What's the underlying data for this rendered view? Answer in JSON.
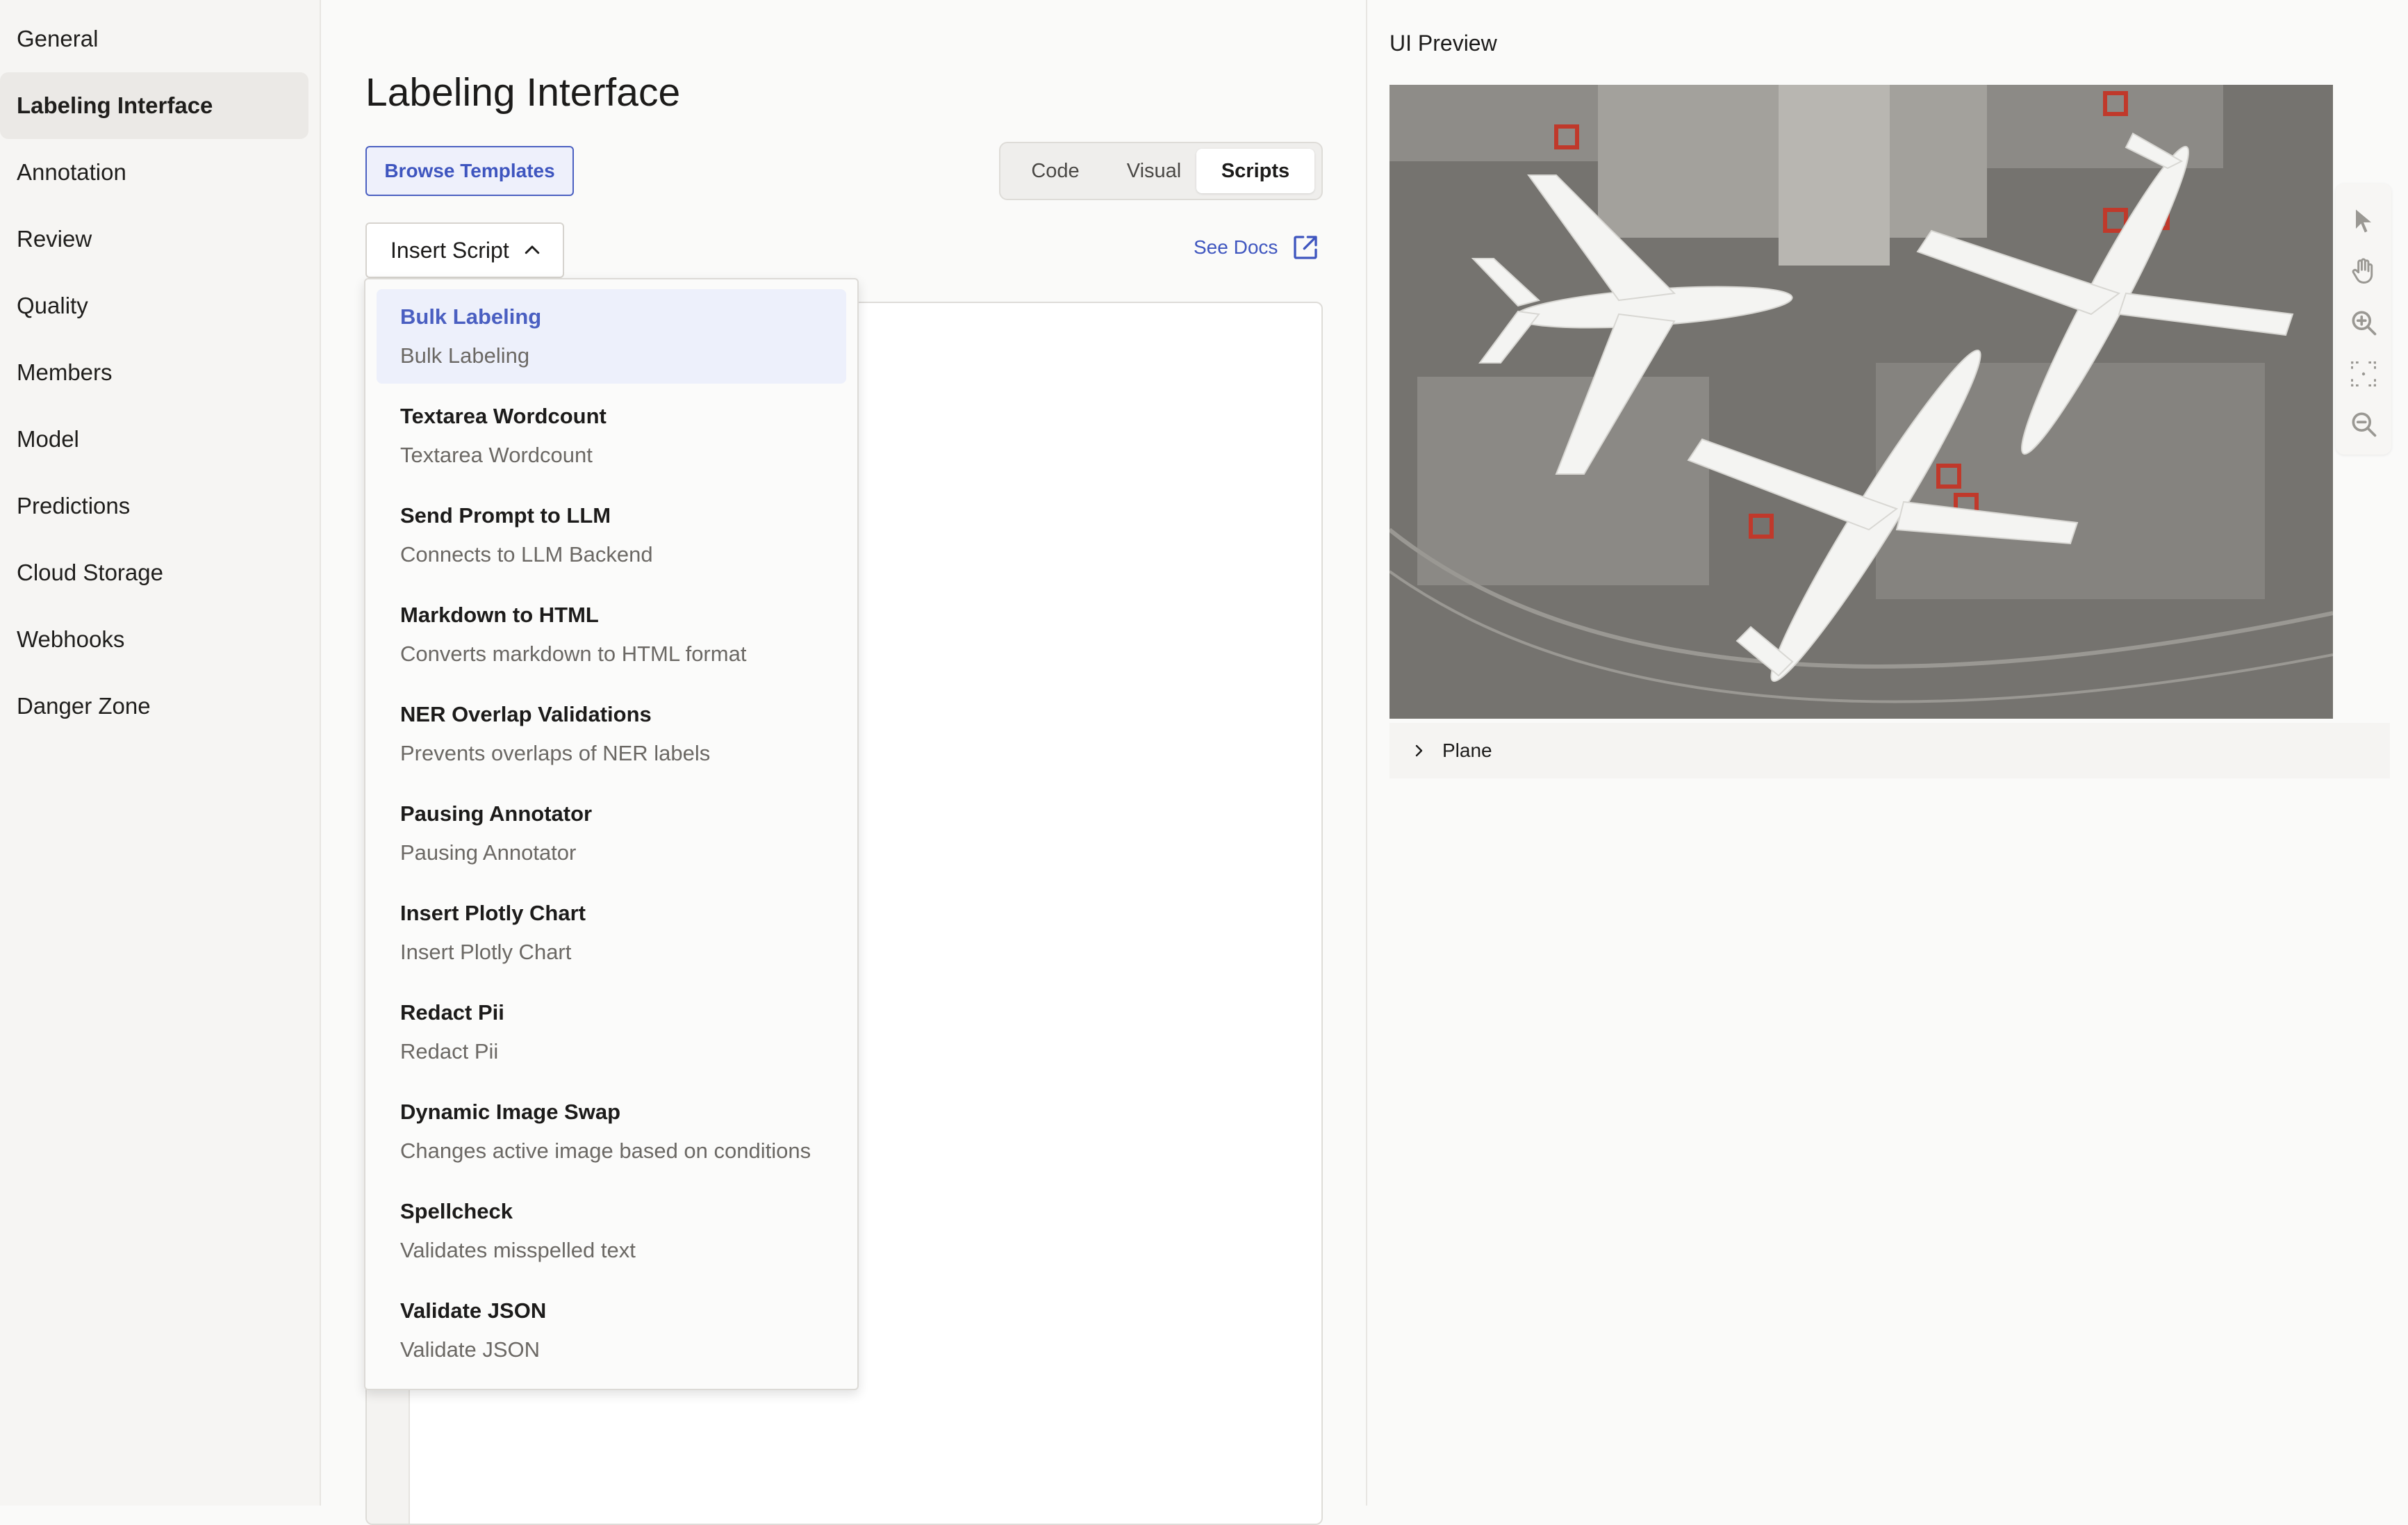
{
  "sidebar": {
    "items": [
      {
        "label": "General"
      },
      {
        "label": "Labeling Interface",
        "active": true
      },
      {
        "label": "Annotation"
      },
      {
        "label": "Review"
      },
      {
        "label": "Quality"
      },
      {
        "label": "Members"
      },
      {
        "label": "Model"
      },
      {
        "label": "Predictions"
      },
      {
        "label": "Cloud Storage"
      },
      {
        "label": "Webhooks"
      },
      {
        "label": "Danger Zone"
      }
    ]
  },
  "main": {
    "title": "Labeling Interface",
    "browse_templates": "Browse Templates",
    "tabs": [
      {
        "label": "Code"
      },
      {
        "label": "Visual"
      },
      {
        "label": "Scripts",
        "active": true
      }
    ],
    "insert_script": "Insert Script",
    "see_docs": "See Docs"
  },
  "dropdown": {
    "items": [
      {
        "title": "Bulk Labeling",
        "subtitle": "Bulk Labeling",
        "active": true
      },
      {
        "title": "Textarea Wordcount",
        "subtitle": "Textarea Wordcount"
      },
      {
        "title": "Send Prompt to LLM",
        "subtitle": "Connects to LLM Backend"
      },
      {
        "title": "Markdown to HTML",
        "subtitle": "Converts markdown to HTML format"
      },
      {
        "title": "NER Overlap Validations",
        "subtitle": "Prevents overlaps of NER labels"
      },
      {
        "title": "Pausing Annotator",
        "subtitle": "Pausing Annotator"
      },
      {
        "title": "Insert Plotly Chart",
        "subtitle": "Insert Plotly Chart"
      },
      {
        "title": "Redact Pii",
        "subtitle": "Redact Pii"
      },
      {
        "title": "Dynamic Image Swap",
        "subtitle": "Changes active image based on conditions"
      },
      {
        "title": "Spellcheck",
        "subtitle": "Validates misspelled text"
      },
      {
        "title": "Validate JSON",
        "subtitle": "Validate JSON"
      }
    ]
  },
  "preview": {
    "title": "UI Preview",
    "label": "Plane",
    "tools": [
      "pointer-icon",
      "hand-icon",
      "zoom-in-icon",
      "fit-icon",
      "zoom-out-icon"
    ]
  },
  "colors": {
    "accent": "#4a5fc1",
    "active_bg": "#edf0fb"
  }
}
